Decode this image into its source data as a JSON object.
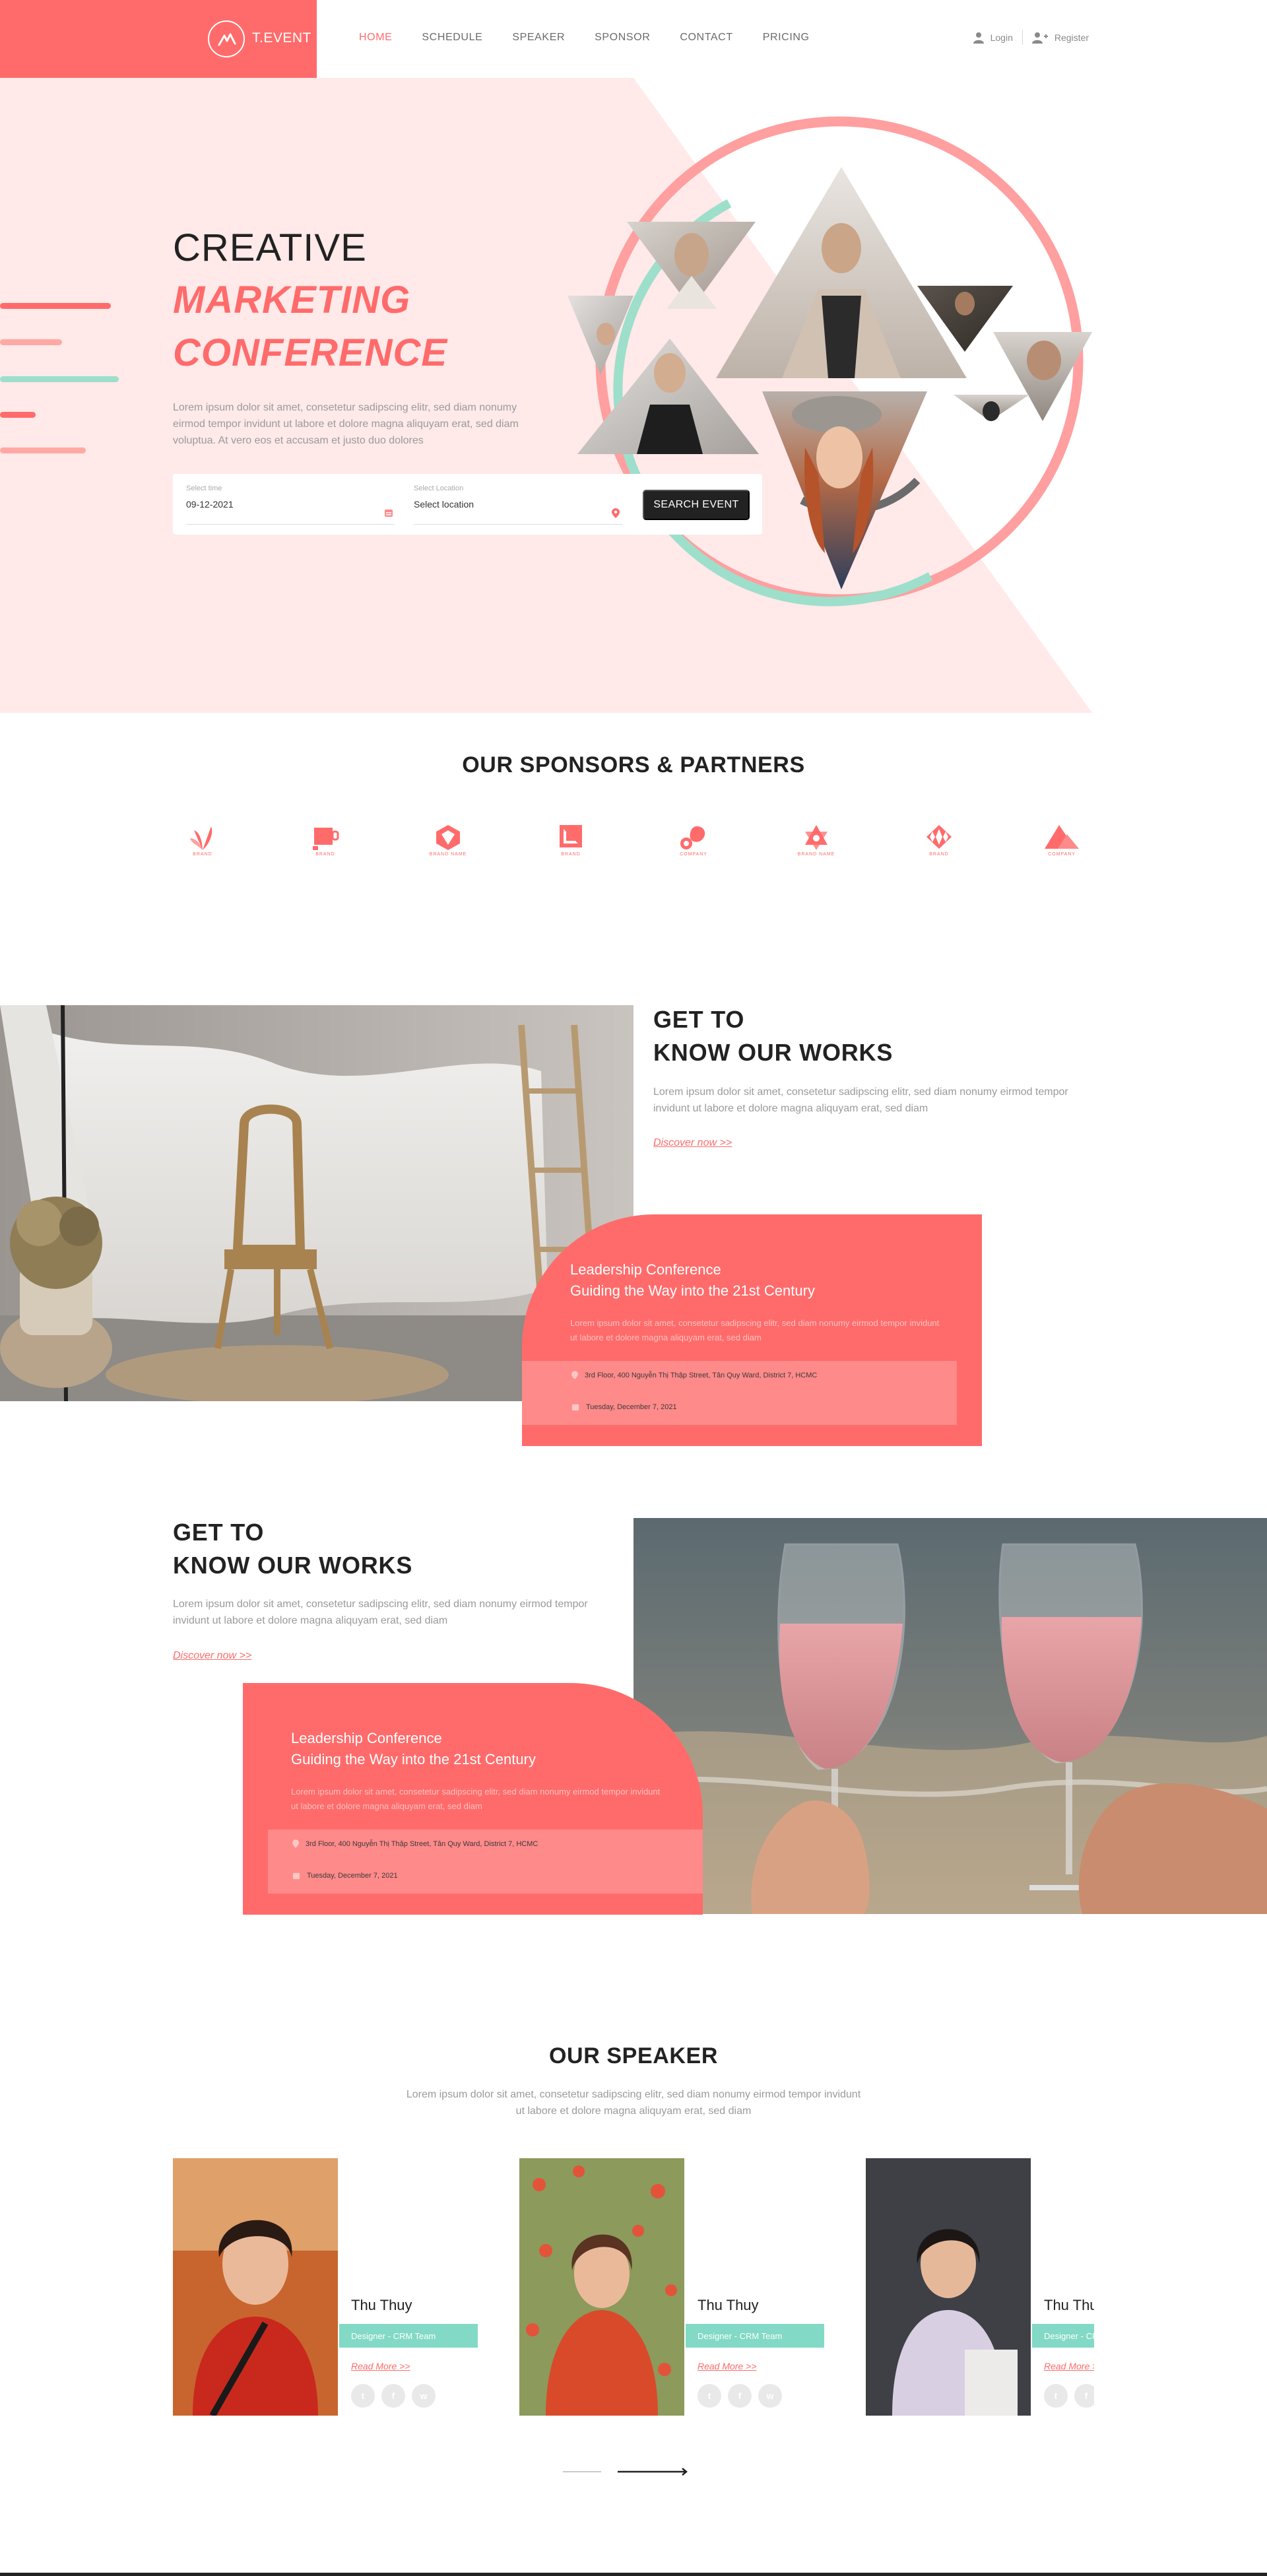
{
  "header": {
    "brand": "T.EVENT",
    "nav": [
      "HOME",
      "SCHEDULE",
      "SPEAKER",
      "SPONSOR",
      "CONTACT",
      "PRICING"
    ],
    "active_nav": "HOME",
    "login": "Login",
    "register": "Register"
  },
  "hero": {
    "title_line1": "CREATIVE",
    "title_line2": "MARKETING",
    "title_line3": "CONFERENCE",
    "description": "Lorem ipsum dolor sit amet, consetetur sadipscing elitr, sed diam nonumy eirmod tempor invidunt ut labore et dolore magna aliquyam erat, sed diam voluptua. At vero eos et accusam et justo duo dolores",
    "search": {
      "time_label": "Select time",
      "time_value": "09-12-2021",
      "location_label": "Select Location",
      "location_value": "Select location",
      "button": "SEARCH EVENT"
    }
  },
  "sponsors": {
    "title": "OUR SPONSORS & PARTNERS",
    "logos": [
      {
        "icon": "leaf-logo",
        "text": "BRAND"
      },
      {
        "icon": "cup-logo",
        "text": "BRAND"
      },
      {
        "icon": "hexagon-logo",
        "text": "BRAND NAME"
      },
      {
        "icon": "square-fold-logo",
        "text": "BRAND"
      },
      {
        "icon": "drop-logo",
        "text": "COMPANY"
      },
      {
        "icon": "star-logo",
        "text": "BRAND NAME"
      },
      {
        "icon": "diamond-logo",
        "text": "BRAND"
      },
      {
        "icon": "mountain-logo",
        "text": "COMPANY"
      }
    ]
  },
  "works": [
    {
      "heading_line1": "GET TO",
      "heading_line2": "KNOW OUR WORKS",
      "description": "Lorem ipsum dolor sit amet, consetetur sadipscing elitr, sed diam nonumy eirmod tempor invidunt ut labore et dolore magna aliquyam erat, sed diam",
      "link": "Discover now >>",
      "card": {
        "title_line1": "Leadership Conference",
        "title_line2": "Guiding the Way into the 21st   Century",
        "description": "Lorem ipsum dolor sit amet, consetetur sadipscing elitr, sed diam nonumy eirmod tempor invidunt ut labore et dolore magna aliquyam erat, sed diam",
        "address": "3rd Floor, 400 Nguyễn Thị Thập Street, Tân Quy Ward, District 7, HCMC",
        "date": "Tuesday, December 7, 2021"
      }
    },
    {
      "heading_line1": "GET TO",
      "heading_line2": "KNOW OUR WORKS",
      "description": "Lorem ipsum dolor sit amet, consetetur sadipscing elitr, sed diam nonumy eirmod tempor invidunt ut labore et dolore magna aliquyam erat, sed diam",
      "link": "Discover now >>",
      "card": {
        "title_line1": "Leadership Conference",
        "title_line2": "Guiding the Way into the 21st   Century",
        "description": "Lorem ipsum dolor sit amet, consetetur sadipscing elitr, sed diam nonumy eirmod tempor invidunt ut labore et dolore magna aliquyam erat, sed diam",
        "address": "3rd Floor, 400 Nguyễn Thị Thập Street, Tân Quy Ward, District 7, HCMC",
        "date": "Tuesday, December 7, 2021"
      }
    }
  ],
  "speakers": {
    "title": "OUR SPEAKER",
    "description": "Lorem ipsum dolor sit amet, consetetur sadipscing elitr, sed diam nonumy eirmod tempor invidunt ut labore et dolore magna aliquyam erat, sed diam",
    "items": [
      {
        "name": "Thu Thuy",
        "role": "Designer - CRM Team",
        "link": "Read More >>"
      },
      {
        "name": "Thu Thuy",
        "role": "Designer - CRM Team",
        "link": "Read More >>"
      },
      {
        "name": "Thu Thuy",
        "role": "Designer - CRM Team",
        "link": "Read More >>"
      }
    ],
    "social_icons": [
      "twitter-icon",
      "facebook-icon",
      "whatsapp-icon"
    ]
  },
  "colors": {
    "accent": "#FF6B6B",
    "hero_bg": "#FFE9E9",
    "teal": "#82D9C5",
    "dark": "#222222"
  }
}
